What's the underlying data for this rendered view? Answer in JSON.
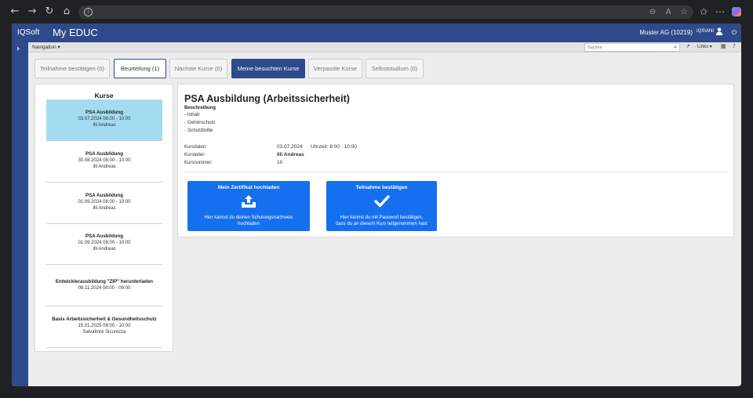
{
  "browser": {},
  "app": {
    "brand": "IQSoft",
    "title": "My EDUC",
    "company": "Muster AG (10219)",
    "user": "IQS\\ANI"
  },
  "toolbar": {
    "navigation_label": "Navigation",
    "search_placeholder": "Suchen",
    "links_label": "Links"
  },
  "tabs": [
    {
      "label": "Teilnahme bestätigen (0)"
    },
    {
      "label": "Beurteilung (1)"
    },
    {
      "label": "Nächste Kurse (0)"
    },
    {
      "label": "Meine besuchten Kurse"
    },
    {
      "label": "Verpasste Kurse"
    },
    {
      "label": "Selbststudium (0)"
    }
  ],
  "courses": {
    "title": "Kurse",
    "items": [
      {
        "name": "PSA Ausbildung",
        "date": "03.07.2024 08:00 - 10:00",
        "instructor": "Illi Andreas",
        "selected": true
      },
      {
        "name": "PSA Ausbildung",
        "date": "30.08.2024 08:00 - 10:00",
        "instructor": "Illi Andreas"
      },
      {
        "name": "PSA Ausbildung",
        "date": "01.09.2024 08:00 - 10:00",
        "instructor": "Illi Andreas"
      },
      {
        "name": "PSA Ausbildung",
        "date": "01.09.2024 08:00 - 10:00",
        "instructor": "Illi Andreas"
      },
      {
        "name": "Entwicklerausbildung \"ZIP\" herunterladen",
        "date": "08.11.2024 08:00 - 09:00",
        "instructor": ""
      },
      {
        "name": "Basis Arbeitssicherheit & Gesundheitsschutz",
        "date": "15.01.2025 08:00 - 10:00",
        "instructor": "Salvattore Sicurezza"
      }
    ]
  },
  "detail": {
    "title": "PSA Ausbildung (Arbeitssicherheit)",
    "description_label": "Beschreibung",
    "description_items": [
      "- Inhalt",
      "- Gehörschutz",
      "- Schutzbrille"
    ],
    "kursdaten_label": "Kursdaten:",
    "kursdaten_value": "03.07.2024",
    "uhrzeit": "Uhrzeit: 8:00 - 10:00",
    "kursleiter_label": "Kursleiter:",
    "kursleiter_value": "Illi Andreas",
    "kursnummer_label": "Kursnummer:",
    "kursnummer_value": "10"
  },
  "actions": {
    "upload_title": "Mein Zertifikat hochladen",
    "upload_text_1": "Hier kannst du deinen Schulungsnachweis",
    "upload_text_2": "hochladen",
    "confirm_title": "Teilnahme bestätigen",
    "confirm_text_1": "Hier kannst du mit Passwort bestätigen,",
    "confirm_text_2": "dass du an diesem Kurs teilgenommen hast"
  },
  "colors": {
    "header": "#2e4a8a",
    "selected": "#a3dcf0",
    "action": "#1570ef"
  }
}
